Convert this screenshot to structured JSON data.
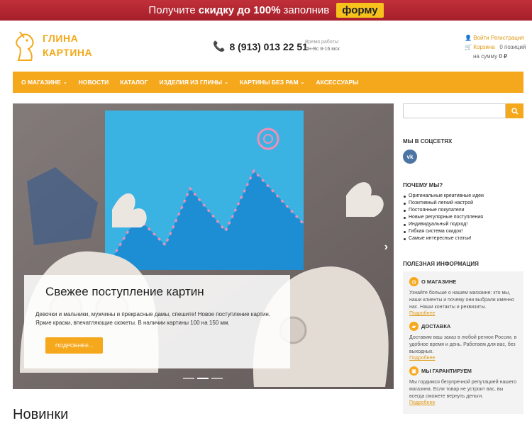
{
  "promo": {
    "pre": "Получите",
    "bold": "скидку до 100%",
    "post": "заполнив",
    "button": "форму"
  },
  "logo": {
    "line1": "ГЛИНА",
    "line2": "КАРТИНА"
  },
  "contact": {
    "phone": "8 (913) 013 22 51",
    "hours_label": "Время работы:",
    "hours": "Пн-Вс 8-16 мск"
  },
  "account": {
    "login": "Войти",
    "register": "Регистрация",
    "cart_label": "Корзина",
    "cart_count": "0 позиций",
    "cart_sum_label": "на сумму",
    "cart_sum": "0 ₽"
  },
  "nav": [
    {
      "label": "О МАГАЗИНЕ",
      "has_menu": true
    },
    {
      "label": "НОВОСТИ",
      "has_menu": false
    },
    {
      "label": "КАТАЛОГ",
      "has_menu": false
    },
    {
      "label": "ИЗДЕЛИЯ ИЗ ГЛИНЫ",
      "has_menu": true
    },
    {
      "label": "КАРТИНЫ БЕЗ РАМ",
      "has_menu": true
    },
    {
      "label": "АКСЕССУАРЫ",
      "has_menu": false
    }
  ],
  "slider": {
    "title": "Свежее поступление картин",
    "text": "Девочки и мальчики, мужчины и прекрасные дамы, спешите! Новое поступление картин. Яркие краски, впечатляющие сюжеты. В наличии картины 100 на 150 мм.",
    "button": "ПОДРОБНЕЕ...",
    "slide_count": 3,
    "active_slide": 2
  },
  "main": {
    "new_title": "Новинки"
  },
  "sidebar": {
    "search_placeholder": "",
    "social_title": "МЫ В СОЦСЕТЯХ",
    "vk": "vk",
    "why_title": "ПОЧЕМУ МЫ?",
    "why_items": [
      "Оригинальные креативные идеи",
      "Позитивный легкий настрой",
      "Постоянные покупатели",
      "Новые регулярные поступления",
      "Индивидуальный подход!",
      "Гибкая система скидок!",
      "Самые интересные статьи!"
    ],
    "info_title": "ПОЛЕЗНАЯ ИНФОРМАЦИЯ",
    "info": [
      {
        "title": "О МАГАЗИНЕ",
        "icon": "clock-icon",
        "text": "Узнайте больше о нашем магазине: кто мы, наши клиенты и почему они выбрали именно нас. Наши контакты и реквизиты.",
        "link": "Подробнее"
      },
      {
        "title": "ДОСТАВКА",
        "icon": "truck-icon",
        "text": "Доставим ваш заказ в любой регион России, в удобное время и день. Работаем для вас, без выходных.",
        "link": "Подробнее"
      },
      {
        "title": "МЫ ГАРАНТИРУЕМ",
        "icon": "lock-icon",
        "text": "Мы гордимся безупречной репутацией нашего магазина. Если товар не устроит вас, вы всегда сможете вернуть деньги.",
        "link": "Подробнее"
      }
    ]
  },
  "colors": {
    "accent": "#f6a81d",
    "promo": "#b32632",
    "vk": "#4c75a3"
  }
}
